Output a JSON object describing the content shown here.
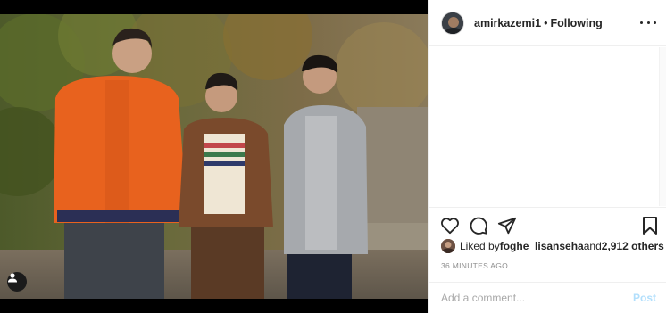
{
  "post": {
    "author": "amirkazemi1",
    "separator": "•",
    "follow_status": "Following"
  },
  "likes": {
    "prefix": "Liked by ",
    "liker": "foghe_lisanseha",
    "middle": " and ",
    "count_text": "2,912 others"
  },
  "timestamp": "36 MINUTES AGO",
  "comment_box": {
    "placeholder": "Add a comment...",
    "post_label": "Post"
  },
  "icons": {
    "like": "heart-icon",
    "comment": "comment-bubble-icon",
    "share": "paper-plane-icon",
    "save": "bookmark-icon",
    "more": "more-options-icon",
    "user_tags": "user-tag-icon"
  },
  "colors": {
    "text": "#262626",
    "muted": "#8e8e8e",
    "post_disabled": "#b2dffc",
    "divider": "#efefef"
  }
}
